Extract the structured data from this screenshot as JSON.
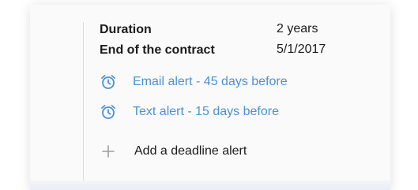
{
  "details": {
    "duration_label": "Duration",
    "duration_value": "2 years",
    "end_label": "End of the contract",
    "end_value": "5/1/2017"
  },
  "alerts": [
    {
      "text": "Email alert - 45 days before",
      "icon": "alarm-clock-icon"
    },
    {
      "text": "Text alert - 15 days before",
      "icon": "alarm-clock-icon"
    }
  ],
  "add_alert": {
    "label": "Add a deadline alert",
    "icon": "plus-icon"
  },
  "colors": {
    "accent": "#4a90d9",
    "text": "#1b1b1b",
    "muted_icon": "#9e9e9e"
  }
}
